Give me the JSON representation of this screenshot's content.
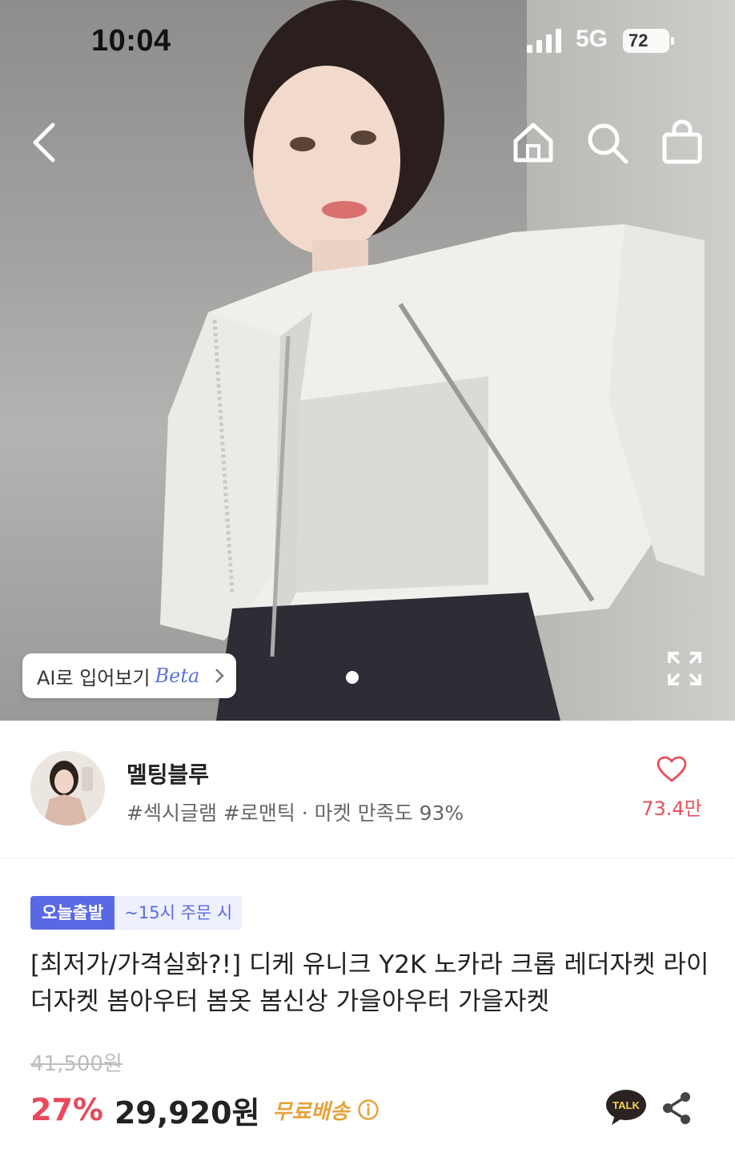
{
  "status_bar": {
    "time": "10:04",
    "network": "5G",
    "battery": "72"
  },
  "ai_try_on": {
    "label": "AI로 입어보기",
    "beta": "Beta"
  },
  "shop": {
    "name": "멜팅블루",
    "tags": "#섹시글램 #로맨틱 · 마켓 만족도 93%",
    "likes": "73.4만"
  },
  "product": {
    "badge_today": "오늘출발",
    "badge_time": "~15시 주문 시",
    "title": "[최저가/가격실화?!] 디케 유니크 Y2K 노카라 크롭 레더자켓 라이더자켓 봄아우터 봄옷 봄신상 가을아우터 가을자켓",
    "original_price": "41,500원",
    "discount": "27%",
    "price": "29,920원",
    "shipping": "무료배송"
  },
  "talk": {
    "label": "TALK"
  },
  "colors": {
    "accent": "#5b68e6",
    "discount": "#e84a5a",
    "shipping": "#e6a23b"
  },
  "icons": [
    "back-icon",
    "home-icon",
    "search-icon",
    "bag-icon",
    "chevron-right-icon",
    "expand-icon",
    "heart-icon",
    "info-icon",
    "talk-icon",
    "share-icon"
  ]
}
